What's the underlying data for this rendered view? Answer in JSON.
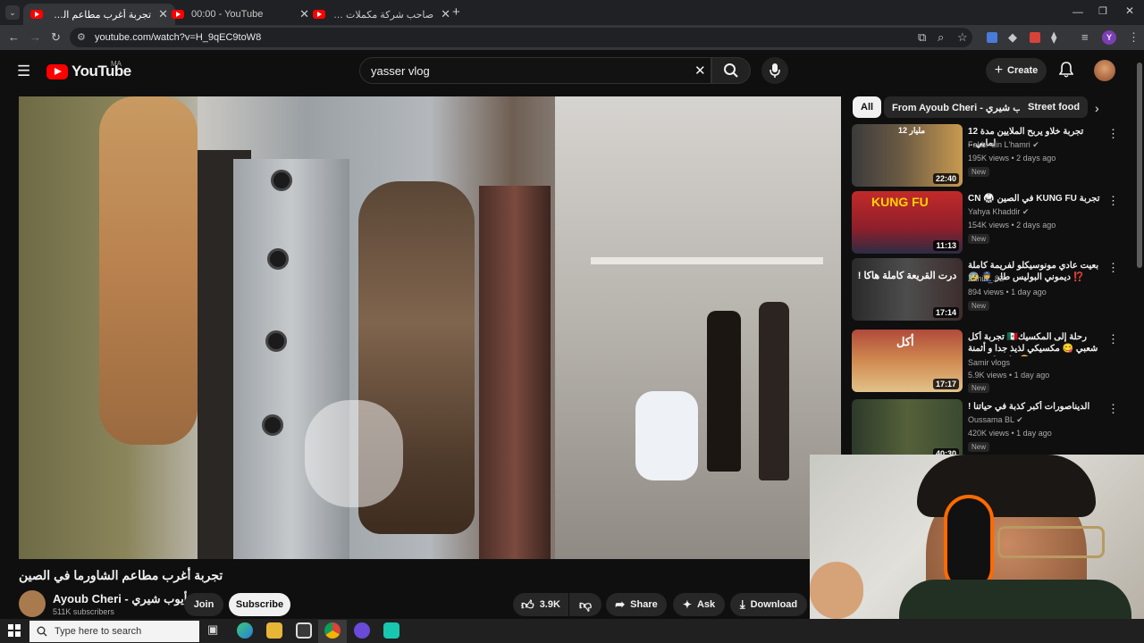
{
  "browser": {
    "tabs": [
      {
        "title": "تجربة أغرب مطاعم الشاورما في ال"
      },
      {
        "title": "00:00 - YouTube"
      },
      {
        "title": "صاحب شركة مكملات عدالية يواجه"
      }
    ],
    "url": "youtube.com/watch?v=H_9qEC9toW8",
    "profile_initial": "Y"
  },
  "header": {
    "logo_text": "YouTube",
    "country": "MA",
    "search_value": "yasser vlog",
    "create_label": "Create"
  },
  "chips": [
    "All",
    "From Ayoub Cheri - أيوب شيري",
    "Street food"
  ],
  "video": {
    "title": "تجربة أغرب مطاعم الشاورما في الصين",
    "channel": "Ayoub Cheri - أيوب شيري",
    "subscribers": "511K subscribers",
    "join_label": "Join",
    "subscribe_label": "Subscribe",
    "likes": "3.9K",
    "share_label": "Share",
    "ask_label": "Ask",
    "download_label": "Download"
  },
  "recommendations": [
    {
      "title": "تجربة خلاو يربح الملايين مدة 12 لمايي...",
      "channel": "Fakhr-din L'hamri",
      "views": "195K views • 2 days ago",
      "badge": "New",
      "duration": "22:40",
      "thumb_text": "12 مليار"
    },
    {
      "title": "تجربة KUNG FU في الصين 🥋 CN",
      "channel": "Yahya Khaddir",
      "views": "154K views • 2 days ago",
      "badge": "New",
      "duration": "11:13",
      "thumb_text": "KUNG FU"
    },
    {
      "title": "بعيت عادي مونوسيكلو لفريمة كاملة ⁉️ ديموني البوليس طلر 👮 😰",
      "channel": "Zahiri_.82",
      "views": "894 views • 1 day ago",
      "badge": "New",
      "duration": "17:14",
      "thumb_text": "درت القريعة كاملة هاكا !"
    },
    {
      "title": "رحلة إلى المكسيك🇲🇽 تجربة أكل شعبي 😋 مكسيكي لذيذ جدا و أثمنة 🤗 #streetfood",
      "channel": "Samir vlogs",
      "views": "5.9K views • 1 day ago",
      "badge": "New",
      "duration": "17:17",
      "thumb_text": "أكل"
    },
    {
      "title": "الديناصورات أكبر كذبة في حياتنا !",
      "channel": "Oussama BL",
      "views": "420K views • 1 day ago",
      "badge": "New",
      "duration": "40:30",
      "thumb_text": ""
    }
  ],
  "taskbar": {
    "search_placeholder": "Type here to search"
  }
}
